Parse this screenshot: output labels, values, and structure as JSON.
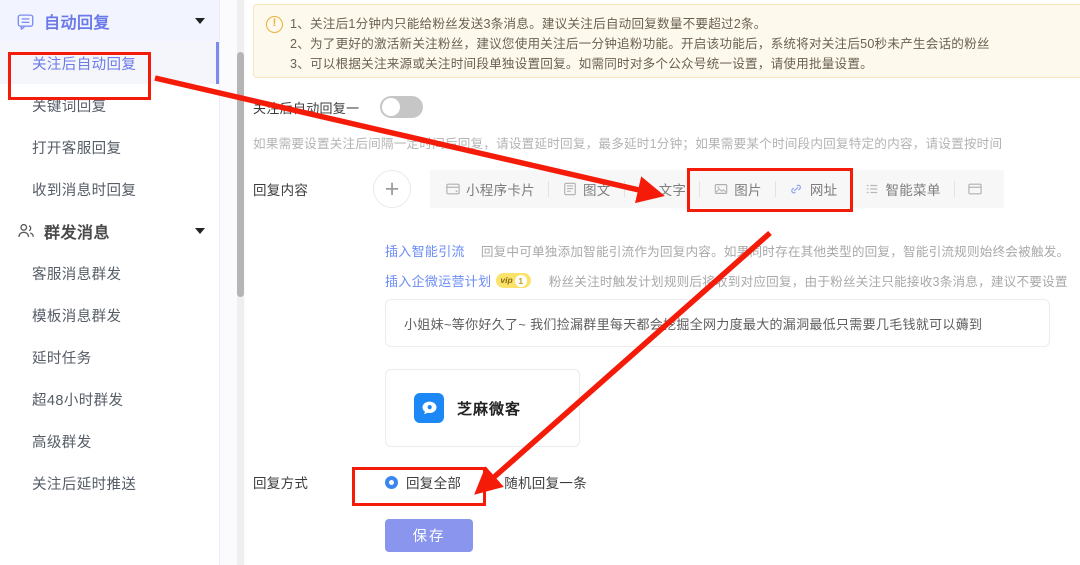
{
  "sidebar": {
    "groups": [
      {
        "title": "自动回复",
        "icon": "chat-box-icon",
        "active": true,
        "items": [
          {
            "label": "关注后自动回复",
            "active": true
          },
          {
            "label": "关键词回复",
            "active": false
          },
          {
            "label": "打开客服回复",
            "active": false
          },
          {
            "label": "收到消息时回复",
            "active": false
          }
        ]
      },
      {
        "title": "群发消息",
        "icon": "users-icon",
        "active": false,
        "items": [
          {
            "label": "客服消息群发",
            "active": false
          },
          {
            "label": "模板消息群发",
            "active": false
          },
          {
            "label": "延时任务",
            "active": false
          },
          {
            "label": "超48小时群发",
            "active": false
          },
          {
            "label": "高级群发",
            "active": false
          },
          {
            "label": "关注后延时推送",
            "active": false
          }
        ]
      }
    ]
  },
  "notice": {
    "icon": "warning-circle-icon",
    "lines": [
      "1、关注后1分钟内只能给粉丝发送3条消息。建议关注后自动回复数量不要超过2条。",
      "2、为了更好的激活新关注粉丝，建议您使用关注后一分钟追粉功能。开启该功能后，系统将对关注后50秒未产生会话的粉丝",
      "3、可以根据关注来源或关注时间段单独设置回复。如需同时对多个公众号统一设置，请使用批量设置。"
    ]
  },
  "toggle_row": {
    "label": "关注后自动回复一",
    "state": "off"
  },
  "hint": "如果需要设置关注后间隔一定时间后回复，请设置延时回复，最多延时1分钟；如果需要某个时间段内回复特定的内容，请设置按时间",
  "reply_content": {
    "label": "回复内容",
    "add_button_icon": "plus-icon",
    "types": [
      {
        "label": "小程序卡片",
        "icon": "mini-program-icon"
      },
      {
        "label": "图文",
        "icon": "article-icon"
      },
      {
        "label": "文字",
        "icon": "text-icon"
      },
      {
        "label": "图片",
        "icon": "image-icon"
      },
      {
        "label": "网址",
        "icon": "link-icon"
      },
      {
        "label": "智能菜单",
        "icon": "menu-list-icon"
      }
    ]
  },
  "links": {
    "smart_traffic": {
      "label": "插入智能引流",
      "desc": "回复中可单独添加智能引流作为回复内容。如果同时存在其他类型的回复，智能引流规则始终会被触发。"
    },
    "qiwei_plan": {
      "label": "插入企微运营计划",
      "badge_text": "vip",
      "badge_num": "1",
      "desc": "粉丝关注时触发计划规则后将收到对应回复，由于粉丝关注只能接收3条消息，建议不要设置"
    }
  },
  "text_card": {
    "content": "小姐妹~等你好久了~ 我们捡漏群里每天都会挖掘全网力度最大的漏洞最低只需要几毛钱就可以薅到"
  },
  "image_card": {
    "name": "芝麻微客",
    "logo_icon": "chat-bubble-icon"
  },
  "reply_method": {
    "label": "回复方式",
    "options": [
      {
        "label": "回复全部",
        "selected": true
      },
      {
        "label": "随机回复一条",
        "selected": false
      }
    ]
  },
  "save": {
    "label": "保存"
  },
  "annotations": {
    "color": "#f41b09",
    "boxes": [
      "关注后自动回复",
      "文字/图片类型按钮",
      "回复全部单选项"
    ],
    "arrows": [
      "指向侧边栏关注后自动回复",
      "指向图文按钮",
      "指向随机回复一条单选项"
    ]
  }
}
